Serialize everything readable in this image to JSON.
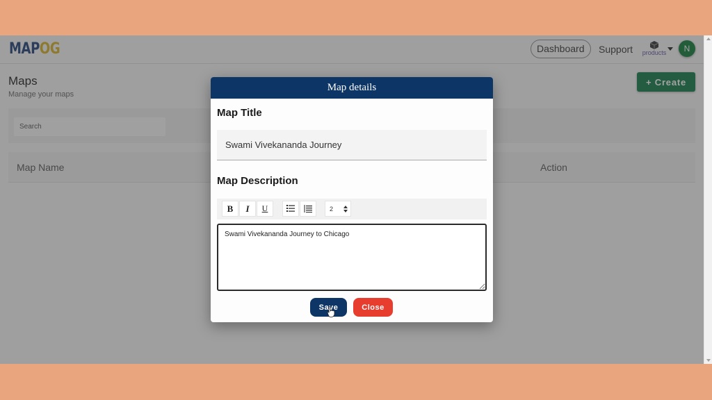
{
  "app": {
    "logo_part1": "MAP",
    "logo_part2": "OG",
    "brand_colors": {
      "navy": "#1d3f7a",
      "gold": "#d6b324"
    }
  },
  "nav": {
    "dashboard": "Dashboard",
    "support": "Support",
    "products": "products",
    "avatar_initial": "N"
  },
  "page": {
    "title": "Maps",
    "subtitle": "Manage your maps",
    "create_label": "+ Create",
    "search_placeholder": "Search",
    "table_headers": [
      "Map Name",
      "Action"
    ]
  },
  "modal": {
    "header": "Map details",
    "title_label": "Map Title",
    "title_value": "Swami Vivekananda Journey",
    "description_label": "Map Description",
    "toolbar": {
      "bold": "B",
      "italic": "I",
      "underline": "U",
      "font_size_value": "2"
    },
    "description_value": "Swami Vivekananda Journey to Chicago",
    "save_label": "Save",
    "close_label": "Close"
  }
}
